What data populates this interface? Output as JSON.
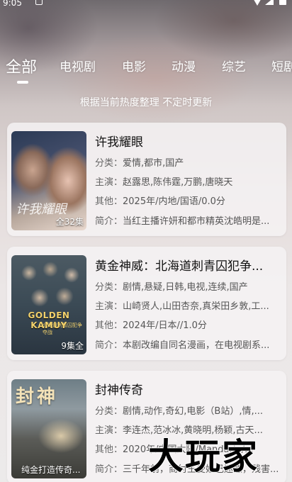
{
  "status_bar": {
    "time": "9:05"
  },
  "tabs": [
    {
      "label": "全部",
      "active": true
    },
    {
      "label": "电视剧"
    },
    {
      "label": "电影"
    },
    {
      "label": "动漫"
    },
    {
      "label": "综艺"
    },
    {
      "label": "短剧"
    }
  ],
  "subtitle": "根据当前热度整理 不定时更新",
  "labels": {
    "category": "分类：",
    "cast": "主演：",
    "other": "其他：",
    "intro": "简介："
  },
  "items": [
    {
      "title": "许我耀眼",
      "badge": "全32集",
      "poster_art": "许我耀眼",
      "category": "爱情,都市,国产",
      "cast": "赵露思,陈伟霆,万鹏,唐晓天",
      "other": "2025年/内地/国语/0.0分",
      "intro": "当红主播许妍和都市精英沈皓明是..."
    },
    {
      "title": "黄金神威：北海道刺青囚犯争...",
      "badge": "9集全",
      "poster_art": "GOLDEN KAMUY",
      "poster_art_sub": "北海道刺青囚犯争夺战",
      "category": "剧情,悬疑,日韩,电视,连续,国产",
      "cast": "山崎贤人,山田杏奈,真栄田乡敦,工...",
      "other": "2024年/日本//1.0分",
      "intro": "本剧改编自同名漫画，在电视剧系..."
    },
    {
      "title": "封神传奇",
      "badge": "纯金打造传奇...",
      "poster_art": "封神",
      "category": "剧情,动作,奇幻,电影（B站）,情,...",
      "cast": "李连杰,范冰冰,黄晓明,杨颖,古天...",
      "other": "2020年/中国大陆/Mandarin/...",
      "intro": "三千年前，商纣王受妲己迷惑，残害..."
    }
  ],
  "watermark": "大玩家"
}
